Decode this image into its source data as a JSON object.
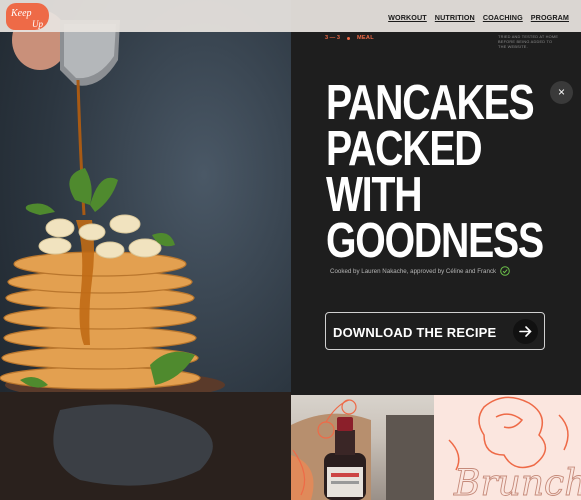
{
  "brand": {
    "logo_text": "Keep Up"
  },
  "nav": {
    "items": [
      "WORKOUT",
      "NUTRITION",
      "COACHING",
      "PROGRAM"
    ]
  },
  "recipe": {
    "index": "3 — 3",
    "category": "MEAL",
    "tested_note": "TRIED AND TESTED AT HOME BEFORE BEING ADDED TO THE WEBSITE.",
    "title": "PANCAKES\nPACKED\nWITH\nGOODNESS",
    "credits": "Cooked by Lauren Nakache, approved by Céline and Franck",
    "download_label": "DOWNLOAD THE RECIPE",
    "close_symbol": "×"
  },
  "thumbnails": {
    "second_script": "Brunch"
  },
  "colors": {
    "accent": "#ee6a47",
    "panel": "#1e1e1e",
    "topbar": "#e8e4e0",
    "check": "#6cc04a"
  }
}
